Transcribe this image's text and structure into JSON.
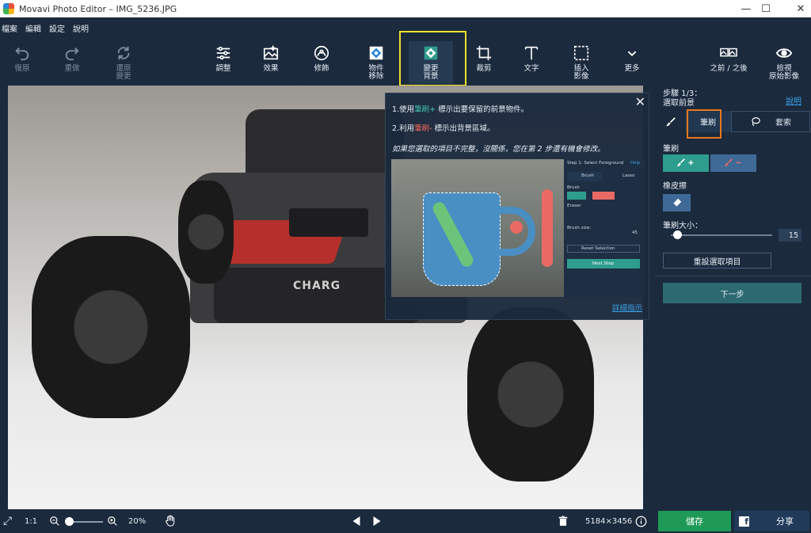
{
  "window": {
    "title": "Movavi Photo Editor – IMG_5236.JPG",
    "minimize": "—",
    "maximize": "☐",
    "close": "✕"
  },
  "menu": [
    "檔案",
    "編輯",
    "設定",
    "說明"
  ],
  "toolbar": {
    "undo": "復原",
    "redo": "重做",
    "restore": "還原\n變更",
    "adjust": "調整",
    "effects": "效果",
    "retouch": "修飾",
    "object_removal": "物件\n移除",
    "change_bg": "變更\n背景",
    "crop": "裁剪",
    "text": "文字",
    "insert_image": "插入\n影像",
    "more": "更多",
    "before_after": "之前 / 之後",
    "view_original": "檢視\n原始影像"
  },
  "canvas": {
    "brand_text": "CHARG"
  },
  "tooltip": {
    "close": "✕",
    "line1_pre": "1.使用",
    "line1_hl": "筆刷+",
    "line1_post": " 標示出要保留的前景物件。",
    "line2_pre": "2.利用",
    "line2_hl": "筆刷-",
    "line2_post": " 標示出背景區域。",
    "line3": "如果您選取的項目不完整，沒關係，您在第 2 步還有機會修改。",
    "demo_panel": {
      "step": "Step 1: Select Foreground",
      "help": "Help",
      "brush": "Brush",
      "lasso": "Lasso",
      "brush_section": "Brush",
      "eraser_section": "Eraser",
      "brush_size": "Brush size:",
      "size_value": "45",
      "reset": "Reset Selection",
      "next": "Next Step"
    },
    "more_link": "詳細指示"
  },
  "panel": {
    "step": "步驟 1/3：",
    "step_sub": "選取前景",
    "help": "說明",
    "tab_brush": "筆刷",
    "tab_lasso": "套索",
    "brush_section": "筆刷",
    "eraser_section": "橡皮擦",
    "brush_size_label": "筆刷大小：",
    "brush_size_value": "15",
    "brush_size_fraction": 0.09,
    "reset": "重設選取項目",
    "next": "下一步"
  },
  "bottom": {
    "fit": "⤢",
    "one_to_one": "1:1",
    "zoom_value": "20%",
    "dimensions": "5184×3456",
    "save": "儲存",
    "share": "分享"
  },
  "colors": {
    "bg": "#1b2a3d",
    "accent_teal": "#2e9d8e",
    "brush_minus": "#3f6a98",
    "save_green": "#1e9a56",
    "highlight_yellow": "#f1df2b",
    "highlight_orange": "#e8791d",
    "link_blue": "#3aa0e6"
  }
}
